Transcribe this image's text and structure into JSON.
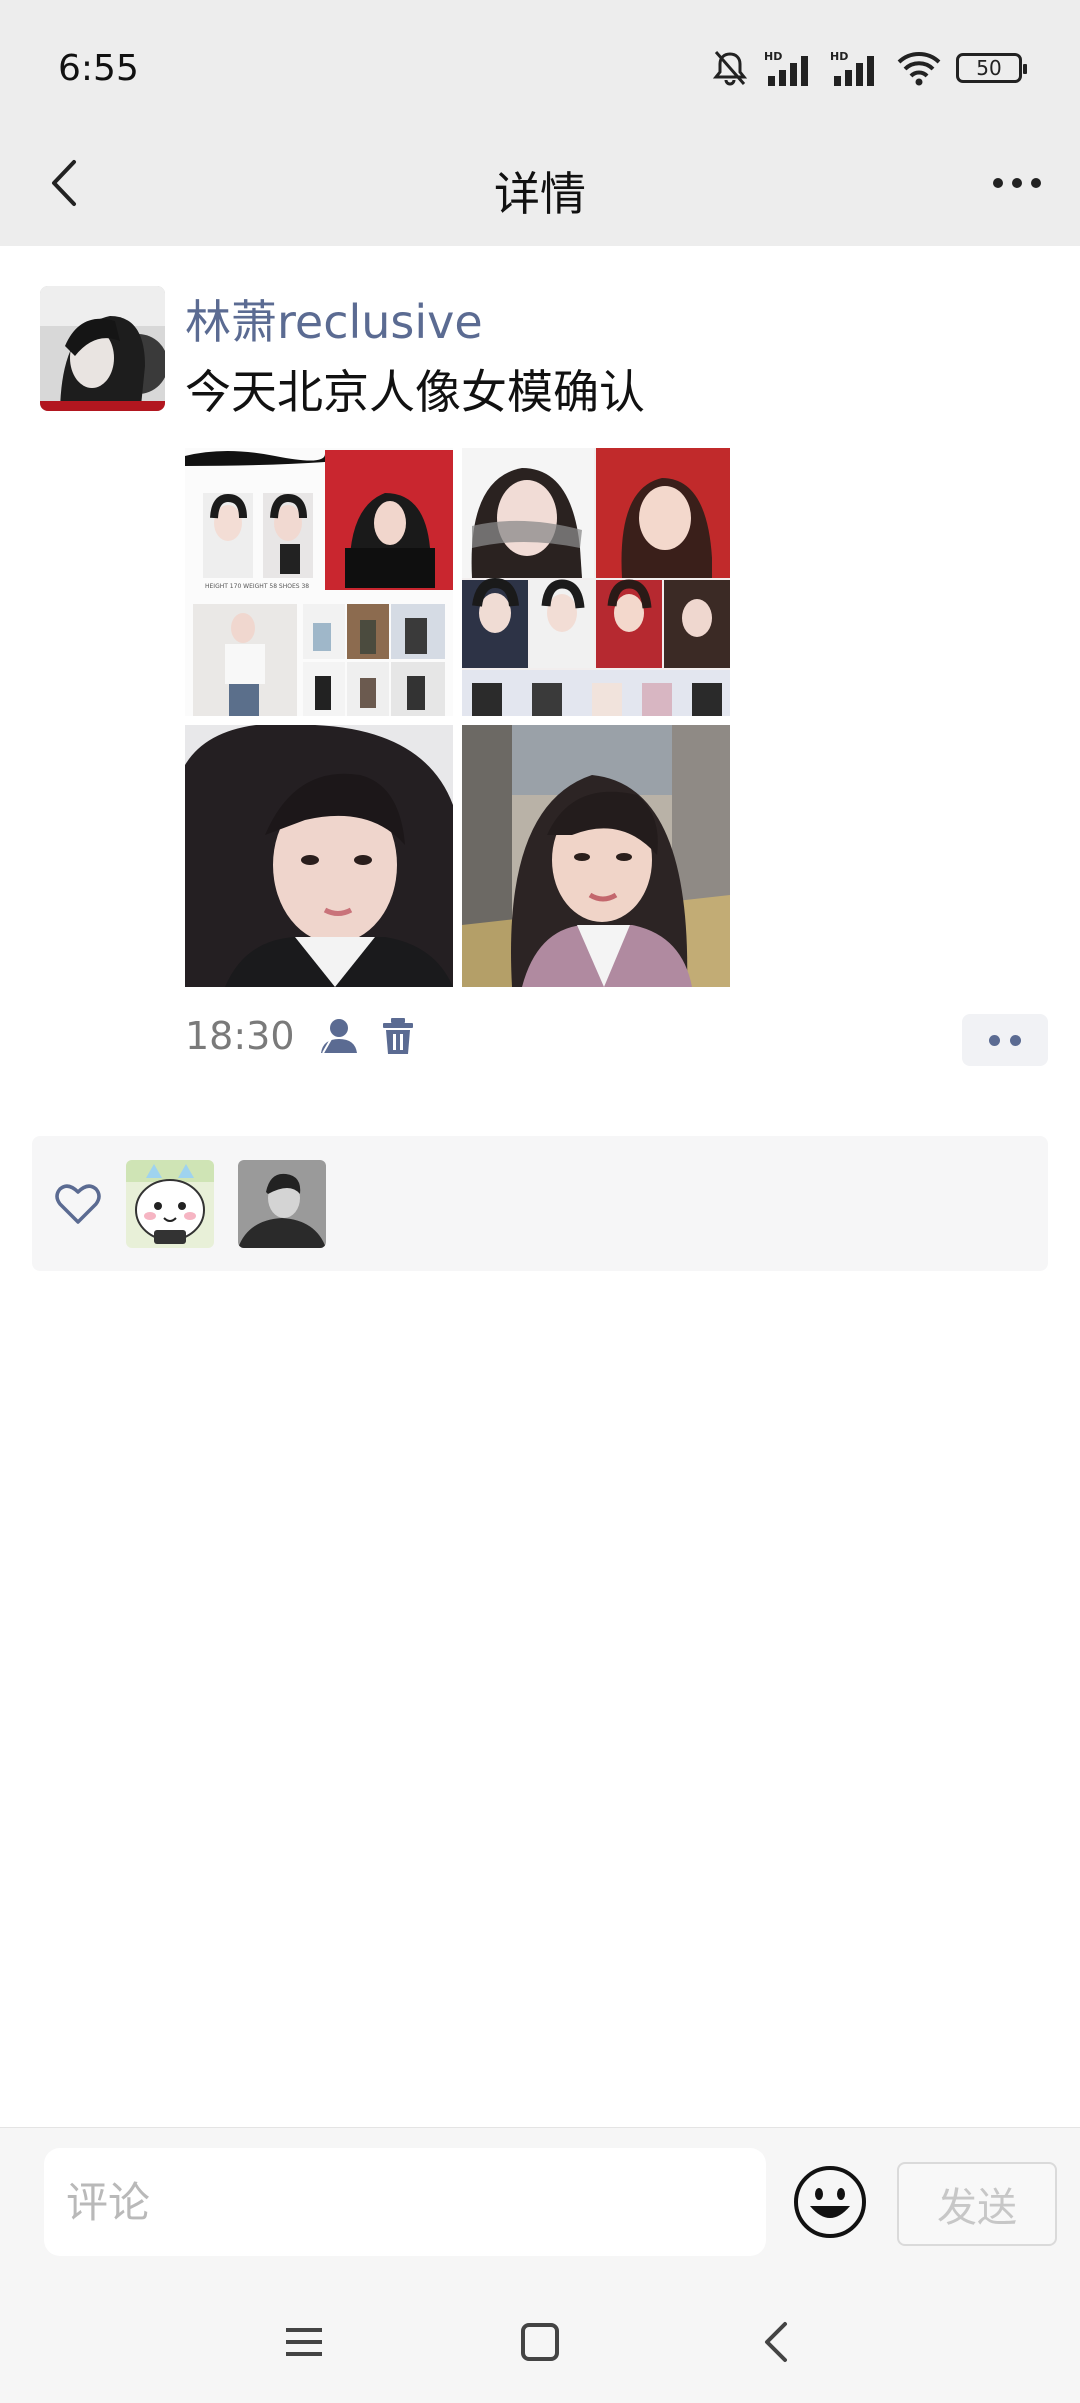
{
  "status_bar": {
    "time": "6:55",
    "battery": "50"
  },
  "header": {
    "title": "详情"
  },
  "post": {
    "author": "林萧reclusive",
    "text": "今天北京人像女模确认",
    "time": "18:30",
    "collage_caption": "HEIGHT 170  WEIGHT 58  SHOES 38"
  },
  "comment_bar": {
    "placeholder": "评论",
    "send_label": "发送"
  },
  "colors": {
    "link": "#5b6b92",
    "bar_bg": "#ededed",
    "likes_bg": "#f6f6f7"
  }
}
